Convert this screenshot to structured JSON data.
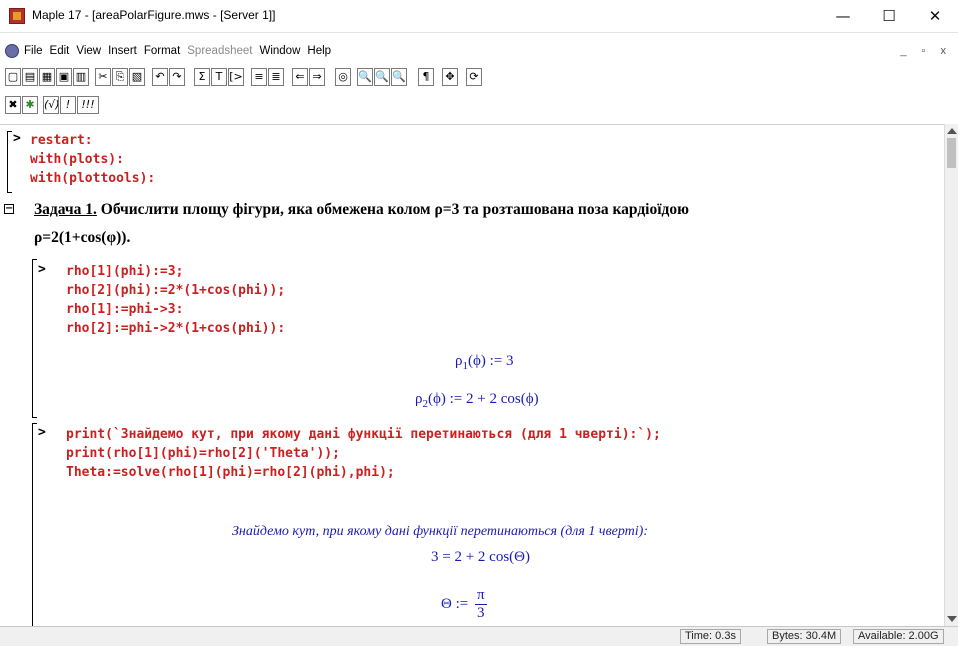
{
  "window": {
    "title": "Maple 17 - [areaPolarFigure.mws - [Server 1]]",
    "minimize": "—",
    "maximize": "☐",
    "close": "✕"
  },
  "menu": {
    "items": [
      "File",
      "Edit",
      "View",
      "Insert",
      "Format",
      "Spreadsheet",
      "Window",
      "Help"
    ],
    "mdi_controls": "_ ▫ x"
  },
  "toolbar1": {
    "buttons": [
      {
        "name": "new-icon",
        "glyph": "▢"
      },
      {
        "name": "open-icon",
        "glyph": "▤"
      },
      {
        "name": "save-all-icon",
        "glyph": "▦"
      },
      {
        "name": "save-icon",
        "glyph": "▣"
      },
      {
        "name": "print-icon",
        "glyph": "▥"
      },
      {
        "name": "cut-icon",
        "glyph": "✂"
      },
      {
        "name": "copy-icon",
        "glyph": "⎘"
      },
      {
        "name": "paste-icon",
        "glyph": "▧"
      },
      {
        "name": "undo-icon",
        "glyph": "↶"
      },
      {
        "name": "redo-icon",
        "glyph": "↷"
      },
      {
        "name": "sum-icon",
        "glyph": "Σ"
      },
      {
        "name": "text-icon",
        "glyph": "T"
      },
      {
        "name": "prompt-icon",
        "glyph": "[>"
      },
      {
        "name": "indent-icon",
        "glyph": "≡"
      },
      {
        "name": "outdent-icon",
        "glyph": "≣"
      },
      {
        "name": "back-icon",
        "glyph": "⇐"
      },
      {
        "name": "forward-icon",
        "glyph": "⇒"
      },
      {
        "name": "stop-icon",
        "glyph": "◎"
      },
      {
        "name": "zoom-100-icon",
        "glyph": "🔍"
      },
      {
        "name": "zoom-150-icon",
        "glyph": "🔍"
      },
      {
        "name": "zoom-200-icon",
        "glyph": "🔍"
      },
      {
        "name": "pilcrow-icon",
        "glyph": "¶"
      },
      {
        "name": "expand-icon",
        "glyph": "✥"
      },
      {
        "name": "restart-icon",
        "glyph": "⟳"
      }
    ]
  },
  "toolbar2": {
    "buttons": [
      {
        "name": "close-group-icon",
        "glyph": "✖"
      },
      {
        "name": "debug-icon",
        "glyph": "✱"
      },
      {
        "name": "evaluate-selection-icon",
        "glyph": "(√)"
      },
      {
        "name": "execute-icon",
        "glyph": "!"
      },
      {
        "name": "execute-all-icon",
        "glyph": "!!!"
      }
    ]
  },
  "worksheet": {
    "prompt": ">",
    "section_toggle": "−",
    "group1_lines": [
      "restart:",
      "with(plots):",
      "with(plottools):"
    ],
    "heading_label": "Задача 1.",
    "heading_text": " Обчислити площу фігури, яка обмежена колом  ρ=3 та розташована поза кардіоїдою",
    "heading_line2": "ρ=2(1+cos(φ)).",
    "group2_lines": [
      "rho[1](phi):=3;",
      "rho[2](phi):=2*(1+cos(phi));",
      "rho[1]:=phi->3:",
      "rho[2]:=phi->2*(1+cos(phi)):"
    ],
    "output1_lhs": "ρ",
    "output1_sub": "1",
    "output1_rhs": "(ϕ) := 3",
    "output2_lhs": "ρ",
    "output2_sub": "2",
    "output2_rhs": "(ϕ) := 2 + 2 cos(ϕ)",
    "group3_lines": [
      "print(`Знайдемо кут, при якому дані функції перетинаються (для 1 чверті):`);",
      "print(rho[1](phi)=rho[2]('Theta'));",
      "Theta:=solve(rho[1](phi)=rho[2](phi),phi);"
    ],
    "output3": "Знайдемо кут, при якому дані функції перетинаються (для 1 чверті):",
    "output4": "3 = 2 + 2 cos(Θ)",
    "output5_lhs": "Θ :=",
    "output5_num": "π",
    "output5_den": "3"
  },
  "status": {
    "time": "Time:  0.3s",
    "bytes": "Bytes: 30.4M",
    "available": "Available: 2.00G"
  }
}
